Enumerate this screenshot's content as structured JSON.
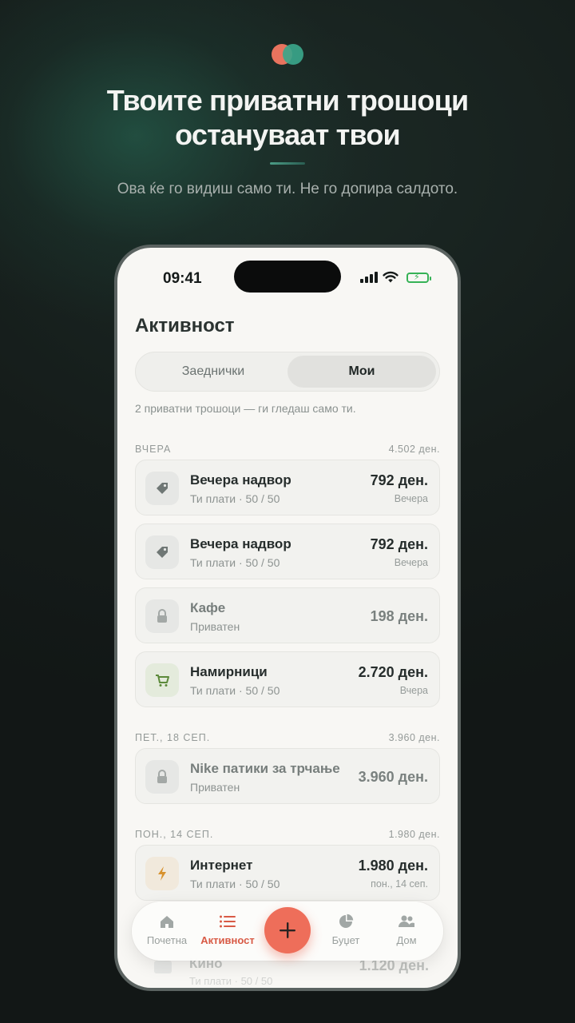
{
  "hero": {
    "headline_line1": "Твоите приватни трошоци",
    "headline_line2": "остануваат твои",
    "subline": "Ова ќе го видиш само ти. Не го допира салдото.",
    "logo_colors": [
      "#e8735e",
      "#3aa58a"
    ]
  },
  "status_bar": {
    "time": "09:41"
  },
  "screen": {
    "title": "Активност",
    "segments": {
      "shared": "Заеднички",
      "mine": "Мои",
      "selected": "Мои"
    },
    "note": "2 приватни трошоци — ги гледаш само ти."
  },
  "sections": [
    {
      "label": "ВЧЕРА",
      "total": "4.502 ден."
    },
    {
      "label": "ПЕТ., 18 СЕП.",
      "total": "3.960 ден."
    },
    {
      "label": "ПОН., 14 СЕП.",
      "total": "1.980 ден."
    }
  ],
  "rows": [
    {
      "name": "Вечера надвор",
      "sub": "Ти плати · 50 / 50",
      "price": "792 ден.",
      "when": "Вечера",
      "icon": "tag-icon"
    },
    {
      "name": "Вечера надвор",
      "sub": "Ти плати · 50 / 50",
      "price": "792 ден.",
      "when": "Вечера",
      "icon": "tag-icon"
    },
    {
      "name": "Кафе",
      "sub": "Приватен",
      "price": "198 ден.",
      "icon": "lock-icon"
    },
    {
      "name": "Намирници",
      "sub": "Ти плати · 50 / 50",
      "price": "2.720 ден.",
      "when": "Вчера",
      "icon": "cart-icon"
    },
    {
      "name": "Nike патики за трчање",
      "sub": "Приватен",
      "price": "3.960 ден.",
      "icon": "lock-icon"
    },
    {
      "name": "Интернет",
      "sub": "Ти плати · 50 / 50",
      "price": "1.980 ден.",
      "when": "пон., 14 сеп.",
      "icon": "bolt-icon"
    }
  ],
  "ghost_row": {
    "name": "Кино",
    "sub": "Ти плати · 50 / 50",
    "price": "1.120 ден."
  },
  "tabbar": {
    "home": "Почетна",
    "activity": "Активност",
    "budget": "Буџет",
    "household": "Дом",
    "active": "Активност"
  },
  "colors": {
    "accent": "#ee6e5a",
    "active_tab": "#d85a45",
    "battery": "#36b256"
  }
}
